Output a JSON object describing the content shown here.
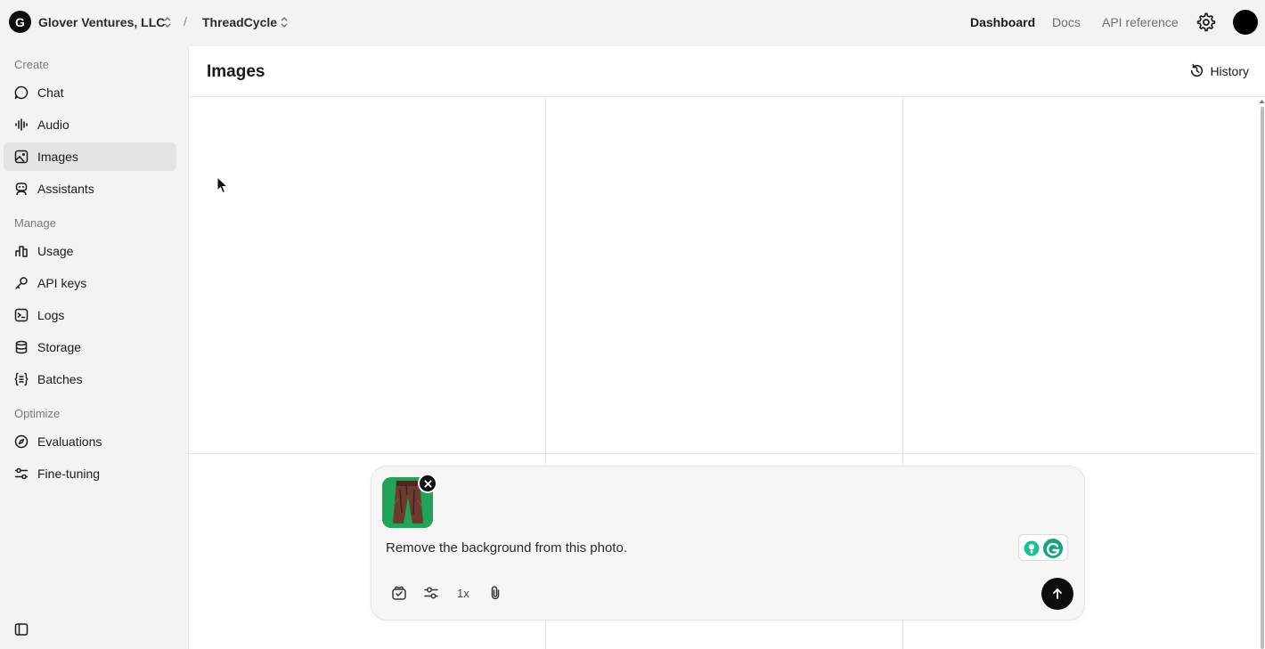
{
  "topbar": {
    "org_initial": "G",
    "org_name": "Glover Ventures, LLC",
    "separator": "/",
    "project_name": "ThreadCycle",
    "nav": [
      {
        "label": "Dashboard",
        "active": true
      },
      {
        "label": "Docs",
        "active": false
      },
      {
        "label": "API reference",
        "active": false
      }
    ],
    "settings_icon": "gear-icon"
  },
  "sidebar": {
    "sections": [
      {
        "label": "Create",
        "items": [
          {
            "label": "Chat",
            "icon": "chat-bubble-icon"
          },
          {
            "label": "Audio",
            "icon": "audio-waveform-icon"
          },
          {
            "label": "Images",
            "icon": "image-icon",
            "active": true
          },
          {
            "label": "Assistants",
            "icon": "robot-icon"
          }
        ]
      },
      {
        "label": "Manage",
        "items": [
          {
            "label": "Usage",
            "icon": "bar-chart-icon"
          },
          {
            "label": "API keys",
            "icon": "key-icon"
          },
          {
            "label": "Logs",
            "icon": "terminal-icon"
          },
          {
            "label": "Storage",
            "icon": "database-icon"
          },
          {
            "label": "Batches",
            "icon": "batches-icon"
          }
        ]
      },
      {
        "label": "Optimize",
        "items": [
          {
            "label": "Evaluations",
            "icon": "compass-icon"
          },
          {
            "label": "Fine-tuning",
            "icon": "sliders-icon"
          }
        ]
      }
    ]
  },
  "main": {
    "title": "Images",
    "history_label": "History"
  },
  "composer": {
    "prompt": "Remove the background from this photo.",
    "count_label": "1x",
    "accent": "#1fa45a"
  },
  "colors": {
    "sidebar_bg": "#f3f3f3",
    "active_item_bg": "#e3e3e3",
    "send_button": "#0d0d0d"
  }
}
